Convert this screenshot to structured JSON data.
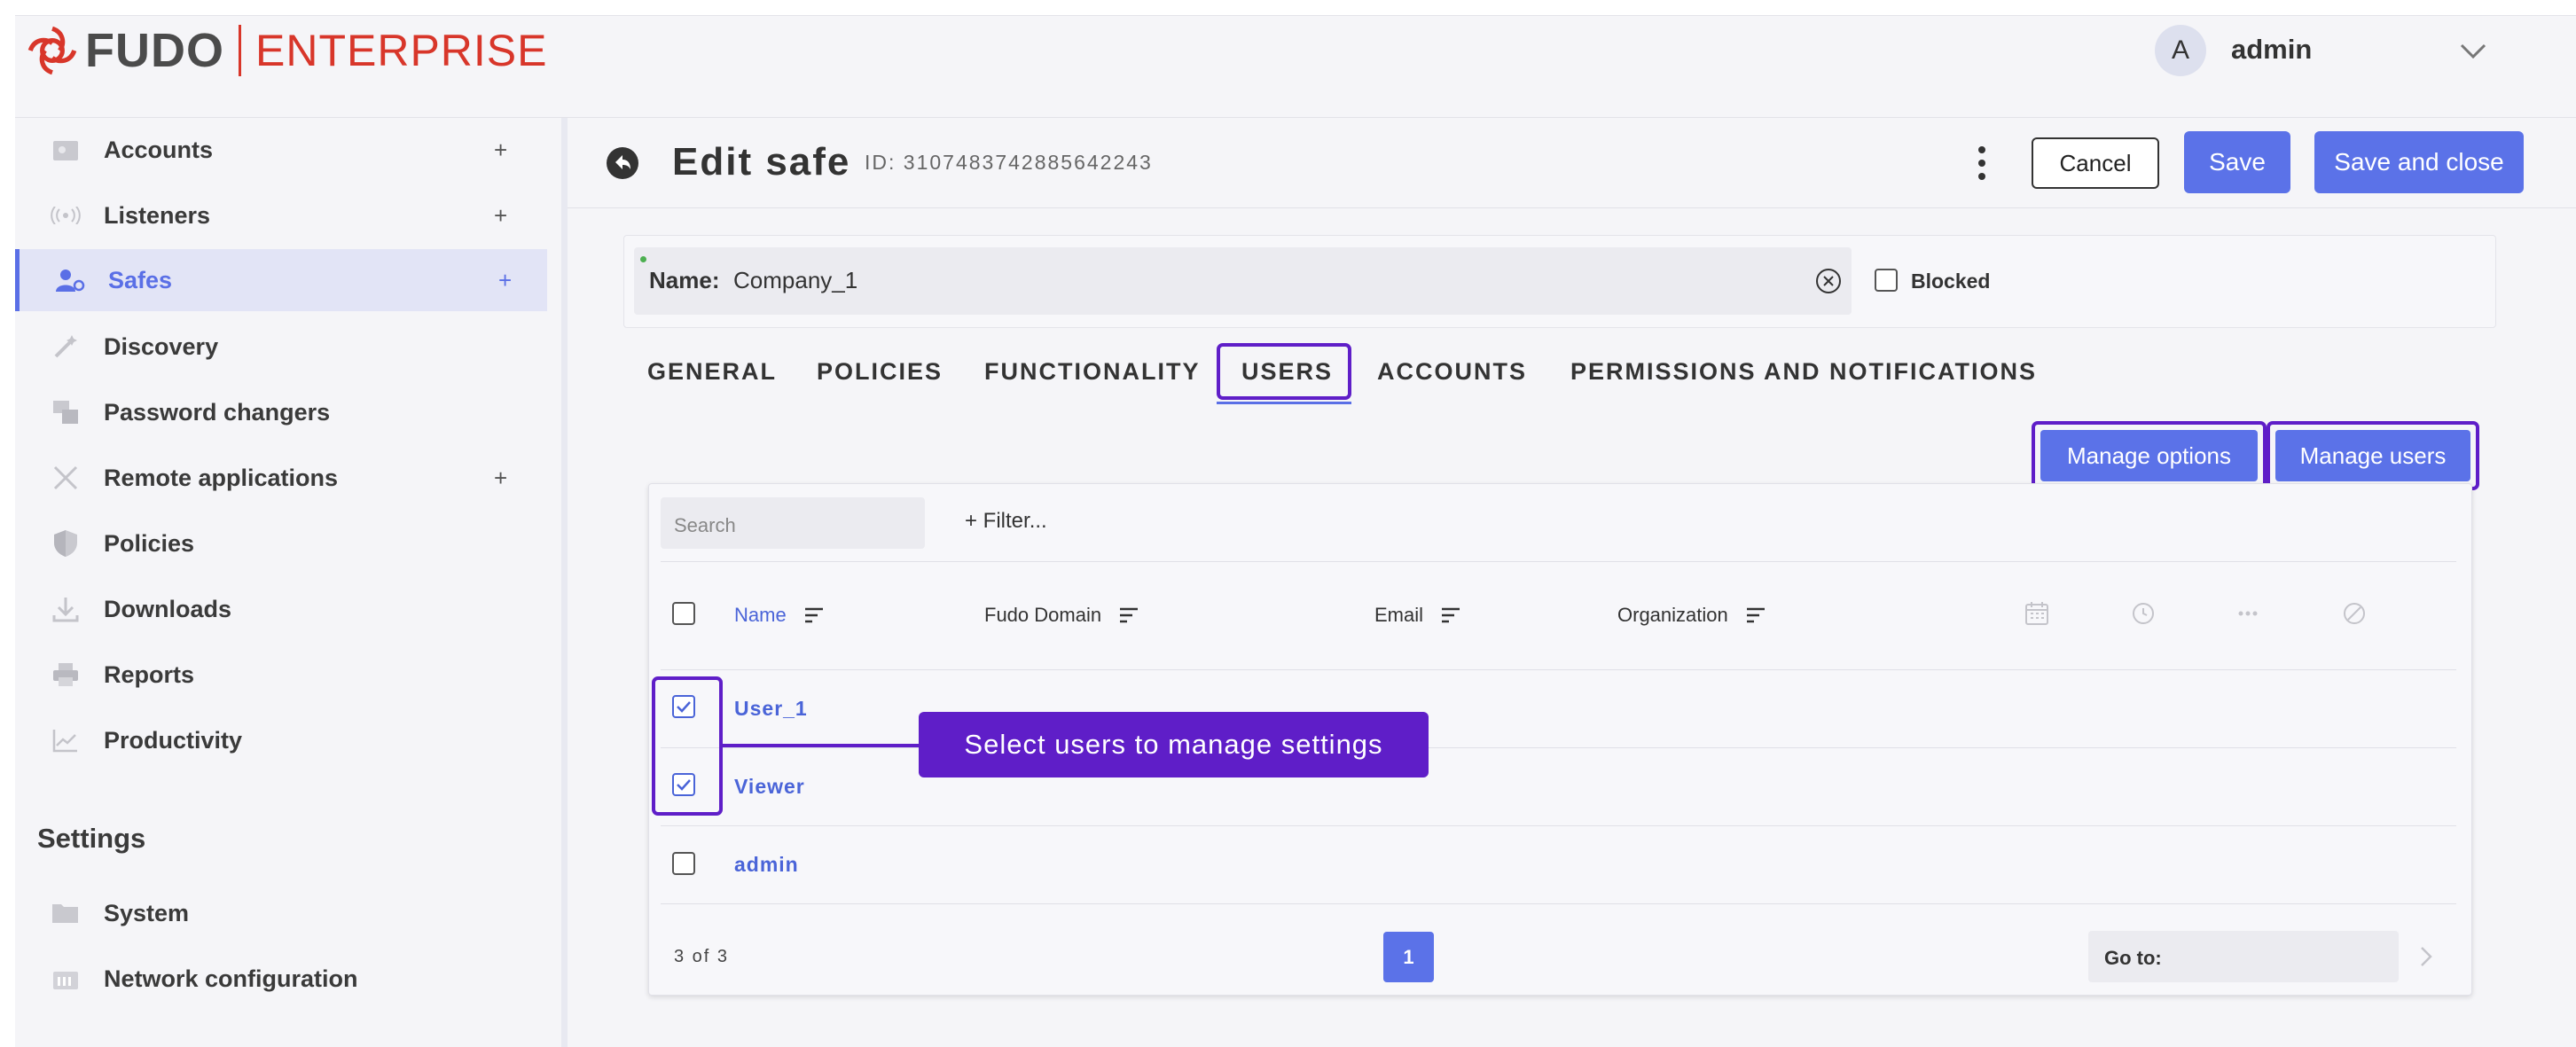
{
  "app": {
    "brand": "FUDO",
    "product": "ENTERPRISE"
  },
  "user": {
    "avatar_letter": "A",
    "name": "admin"
  },
  "sidebar": {
    "items": [
      {
        "label": "Accounts",
        "plus": "+",
        "icon": "accounts-icon"
      },
      {
        "label": "Listeners",
        "plus": "+",
        "icon": "listeners-icon"
      },
      {
        "label": "Safes",
        "plus": "+",
        "icon": "safes-icon",
        "active": true
      },
      {
        "label": "Discovery",
        "plus": "",
        "icon": "discovery-icon"
      },
      {
        "label": "Password changers",
        "plus": "",
        "icon": "password-changers-icon"
      },
      {
        "label": "Remote applications",
        "plus": "+",
        "icon": "remote-applications-icon"
      },
      {
        "label": "Policies",
        "plus": "",
        "icon": "policies-icon"
      },
      {
        "label": "Downloads",
        "plus": "",
        "icon": "downloads-icon"
      },
      {
        "label": "Reports",
        "plus": "",
        "icon": "reports-icon"
      },
      {
        "label": "Productivity",
        "plus": "",
        "icon": "productivity-icon"
      }
    ],
    "settings_heading": "Settings",
    "settings_items": [
      {
        "label": "System",
        "icon": "system-icon"
      },
      {
        "label": "Network configuration",
        "icon": "network-icon"
      }
    ]
  },
  "page": {
    "title": "Edit safe",
    "id": "ID: 3107483742885642243",
    "cancel": "Cancel",
    "save": "Save",
    "save_close": "Save and close"
  },
  "name_field": {
    "label": "Name:",
    "value": "Company_1",
    "blocked_label": "Blocked"
  },
  "tabs": [
    "GENERAL",
    "POLICIES",
    "FUNCTIONALITY",
    "USERS",
    "ACCOUNTS",
    "PERMISSIONS AND NOTIFICATIONS"
  ],
  "active_tab": "USERS",
  "manage": {
    "options": "Manage options",
    "users": "Manage users"
  },
  "table": {
    "search_placeholder": "Search",
    "filter": "+ Filter...",
    "columns": [
      "Name",
      "Fudo Domain",
      "Email",
      "Organization"
    ],
    "rows": [
      {
        "name": "User_1",
        "checked": true
      },
      {
        "name": "Viewer",
        "checked": true
      },
      {
        "name": "admin",
        "checked": false
      }
    ],
    "count": "3 of 3",
    "page": "1",
    "goto": "Go to:"
  },
  "callout": "Select users to manage settings",
  "colors": {
    "accent": "#5b72e8",
    "highlight": "#5f1ec8",
    "brand_red": "#d8362a"
  }
}
